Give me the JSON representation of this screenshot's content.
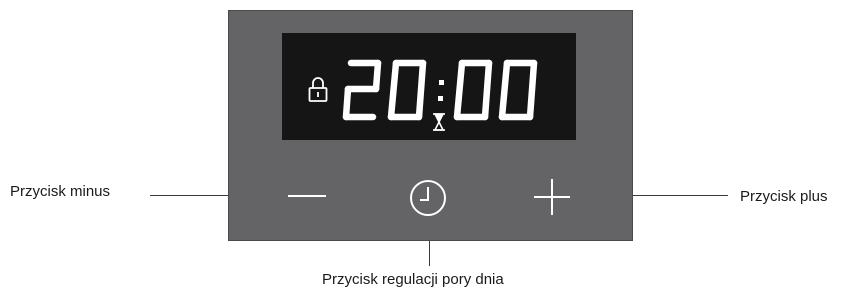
{
  "display": {
    "time": "20:00",
    "indicators": [
      "lock-icon",
      "hourglass-icon"
    ]
  },
  "buttons": {
    "minus": {
      "icon": "minus-icon"
    },
    "clock": {
      "icon": "clock-icon"
    },
    "plus": {
      "icon": "plus-icon"
    }
  },
  "labels": {
    "minus": "Przycisk minus",
    "plus": "Przycisk plus",
    "clock": "Przycisk regulacji pory dnia"
  },
  "colors": {
    "panel": "#646466",
    "display": "#151515",
    "segment": "#ffffff",
    "leader": "#3a3a3a"
  }
}
